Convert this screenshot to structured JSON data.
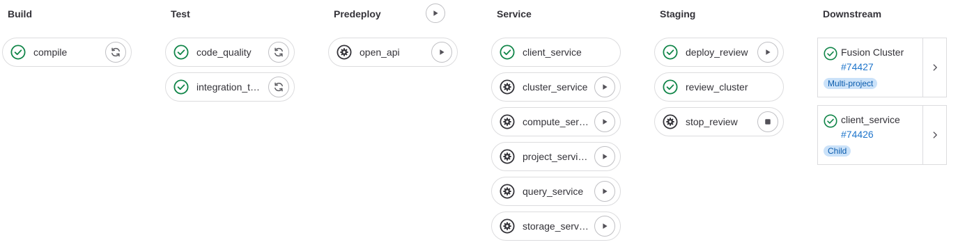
{
  "stages": [
    {
      "title": "Build",
      "jobs": [
        {
          "name": "compile",
          "status": "success",
          "action": "retry"
        }
      ]
    },
    {
      "title": "Test",
      "jobs": [
        {
          "name": "code_quality",
          "status": "success",
          "action": "retry"
        },
        {
          "name": "integration_t…",
          "status": "success",
          "action": "retry"
        }
      ]
    },
    {
      "title": "Predeploy",
      "stage_action": "play",
      "jobs": [
        {
          "name": "open_api",
          "status": "manual",
          "action": "play"
        }
      ]
    },
    {
      "title": "Service",
      "jobs": [
        {
          "name": "client_service",
          "status": "success",
          "action": "none"
        },
        {
          "name": "cluster_service",
          "status": "manual",
          "action": "play"
        },
        {
          "name": "compute_ser…",
          "status": "manual",
          "action": "play"
        },
        {
          "name": "project_servi…",
          "status": "manual",
          "action": "play"
        },
        {
          "name": "query_service",
          "status": "manual",
          "action": "play"
        },
        {
          "name": "storage_serv…",
          "status": "manual",
          "action": "play"
        }
      ]
    },
    {
      "title": "Staging",
      "jobs": [
        {
          "name": "deploy_review",
          "status": "success",
          "action": "play"
        },
        {
          "name": "review_cluster",
          "status": "success",
          "action": "none"
        },
        {
          "name": "stop_review",
          "status": "manual",
          "action": "stop"
        }
      ]
    }
  ],
  "downstream": {
    "title": "Downstream",
    "pipelines": [
      {
        "project": "Fusion Cluster",
        "id": "#74427",
        "badge": "Multi-project",
        "status": "success"
      },
      {
        "project": "client_service",
        "id": "#74426",
        "badge": "Child",
        "status": "success"
      }
    ]
  },
  "colors": {
    "success": "#108548",
    "manual": "#333238",
    "link": "#1f75cb",
    "badge_bg": "#cbe2f9",
    "border": "#dcdcde"
  },
  "icons": {
    "success": "status-success-icon",
    "manual": "status-manual-icon",
    "retry": "retry-icon",
    "play": "play-icon",
    "stop": "stop-icon",
    "expand": "chevron-right-icon"
  }
}
